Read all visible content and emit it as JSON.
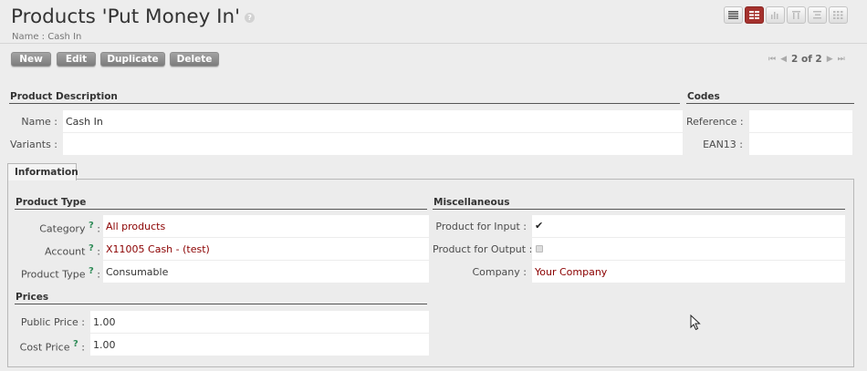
{
  "header": {
    "title": "Products 'Put Money In'",
    "help_glyph": "?",
    "subtitle": "Name : Cash In"
  },
  "view_switcher": [
    {
      "name": "list-view",
      "active": false
    },
    {
      "name": "form-view",
      "active": true
    },
    {
      "name": "graph-view",
      "active": false
    },
    {
      "name": "calendar-view",
      "active": false
    },
    {
      "name": "gantt-view",
      "active": false
    },
    {
      "name": "kanban-view",
      "active": false
    }
  ],
  "actions": {
    "new": "New",
    "edit": "Edit",
    "duplicate": "Duplicate",
    "delete": "Delete"
  },
  "pager": {
    "count": "2 of 2"
  },
  "product_description": {
    "title": "Product Description",
    "name_label": "Name :",
    "name_value": "Cash In",
    "variants_label": "Variants :",
    "variants_value": ""
  },
  "codes": {
    "title": "Codes",
    "reference_label": "Reference :",
    "reference_value": "",
    "ean13_label": "EAN13 :",
    "ean13_value": ""
  },
  "tabs": [
    {
      "label": "Information"
    }
  ],
  "product_type": {
    "title": "Product Type",
    "category_label": "Category",
    "category_value": "All products",
    "account_label": "Account",
    "account_value": "X11005 Cash - (test)",
    "type_label": "Product Type",
    "type_value": "Consumable",
    "help_glyph": "?",
    "colon": ":"
  },
  "prices": {
    "title": "Prices",
    "public_label": "Public Price :",
    "public_value": "1.00",
    "cost_label": "Cost Price",
    "cost_value": "1.00"
  },
  "miscellaneous": {
    "title": "Miscellaneous",
    "input_label": "Product for Input :",
    "input_checked": true,
    "input_mark": "✔",
    "output_label": "Product for Output :",
    "output_checked": false,
    "company_label": "Company :",
    "company_value": "Your Company"
  },
  "colors": {
    "accent": "#a5322e",
    "link": "#8b0000",
    "help": "#2e8b57"
  }
}
